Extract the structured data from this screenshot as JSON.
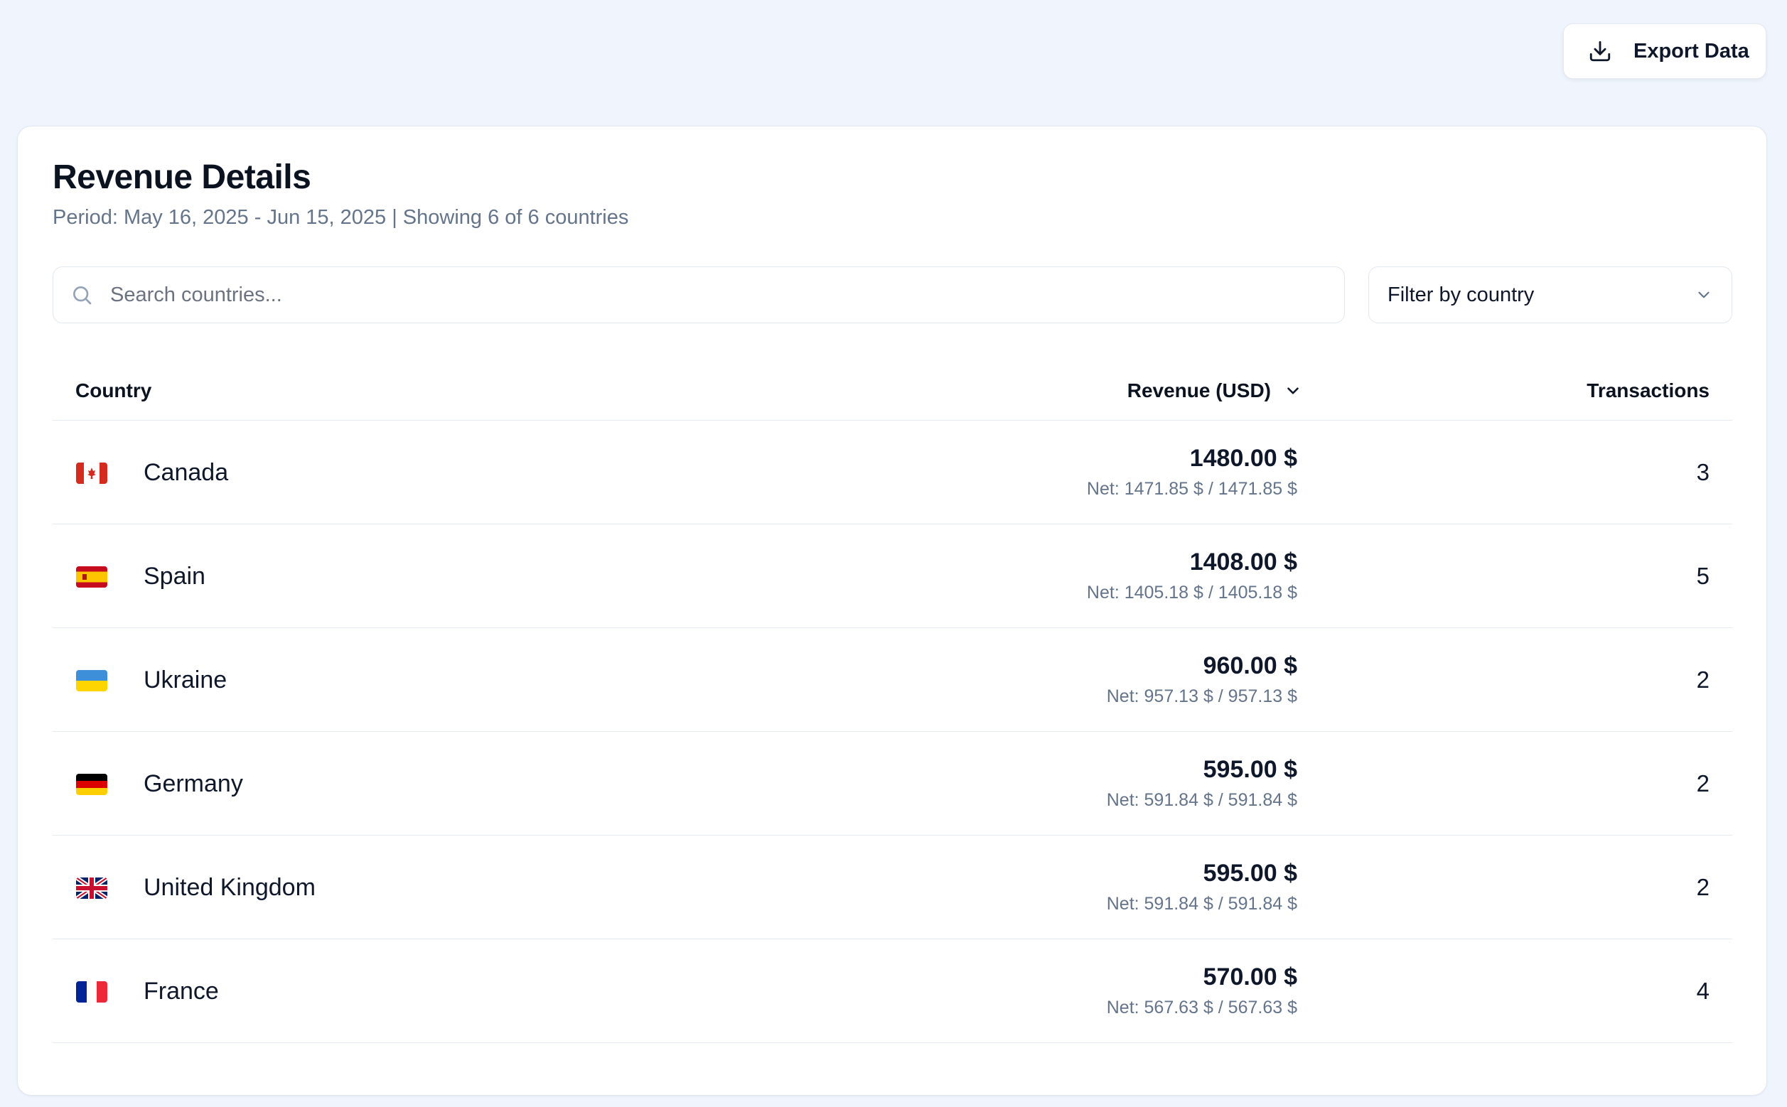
{
  "toolbar": {
    "export_label": "Export Data"
  },
  "card": {
    "title": "Revenue Details",
    "subtitle": "Period: May 16, 2025 - Jun 15, 2025 | Showing 6 of 6 countries"
  },
  "search": {
    "placeholder": "Search countries...",
    "value": ""
  },
  "filter": {
    "label": "Filter by country"
  },
  "table": {
    "headers": {
      "country": "Country",
      "revenue": "Revenue (USD)",
      "transactions": "Transactions"
    },
    "rows": [
      {
        "flag": "canada-flag-icon",
        "country": "Canada",
        "revenue": "1480.00 $",
        "net": "Net: 1471.85 $ / 1471.85 $",
        "transactions": "3"
      },
      {
        "flag": "spain-flag-icon",
        "country": "Spain",
        "revenue": "1408.00 $",
        "net": "Net: 1405.18 $ / 1405.18 $",
        "transactions": "5"
      },
      {
        "flag": "ukraine-flag-icon",
        "country": "Ukraine",
        "revenue": "960.00 $",
        "net": "Net: 957.13 $ / 957.13 $",
        "transactions": "2"
      },
      {
        "flag": "germany-flag-icon",
        "country": "Germany",
        "revenue": "595.00 $",
        "net": "Net: 591.84 $ / 591.84 $",
        "transactions": "2"
      },
      {
        "flag": "uk-flag-icon",
        "country": "United Kingdom",
        "revenue": "595.00 $",
        "net": "Net: 591.84 $ / 591.84 $",
        "transactions": "2"
      },
      {
        "flag": "france-flag-icon",
        "country": "France",
        "revenue": "570.00 $",
        "net": "Net: 567.63 $ / 567.63 $",
        "transactions": "4"
      }
    ]
  },
  "colors": {
    "background": "#eff4fd",
    "card": "#ffffff",
    "text_primary": "#0f172a",
    "text_muted": "#64748b",
    "border": "#e2e8f0"
  }
}
